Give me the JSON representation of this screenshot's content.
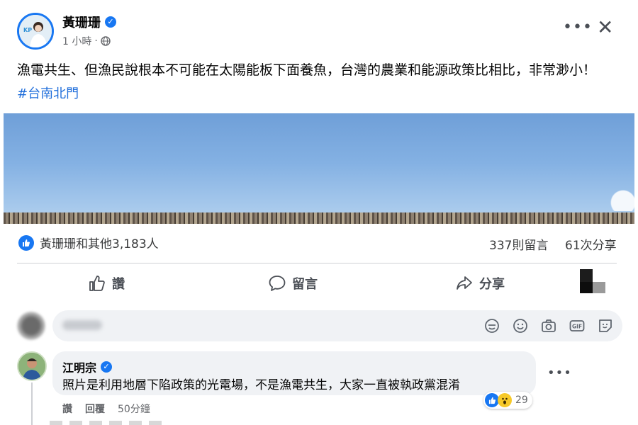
{
  "post": {
    "author": "黃珊珊",
    "time": "1 小時",
    "time_separator": "·",
    "privacy_icon": "globe-icon",
    "text": "漁電共生、但漁民說根本不可能在太陽能板下面養魚，台灣的農業和能源政策比相比，非常渺小！",
    "hashtag": "#台南北門"
  },
  "header": {
    "more_label": "•••",
    "close_label": "✕"
  },
  "reactions": {
    "summary": "黃珊珊和其他3,183人",
    "comments": "337則留言",
    "shares": "61次分享"
  },
  "actions": {
    "like": "讚",
    "comment": "留言",
    "share": "分享"
  },
  "comment": {
    "author": "江明宗",
    "text": "照片是利用地層下陷政策的光電場，不是漁電共生，大家一直被執政黨混淆",
    "reaction_count": "29",
    "like_label": "讚",
    "reply_label": "回覆",
    "time": "50分鐘"
  },
  "colors": {
    "accent": "#1877f2",
    "hashtag": "#216fdb",
    "secondary_text": "#65676b",
    "composer_bg": "#f0f2f5"
  }
}
